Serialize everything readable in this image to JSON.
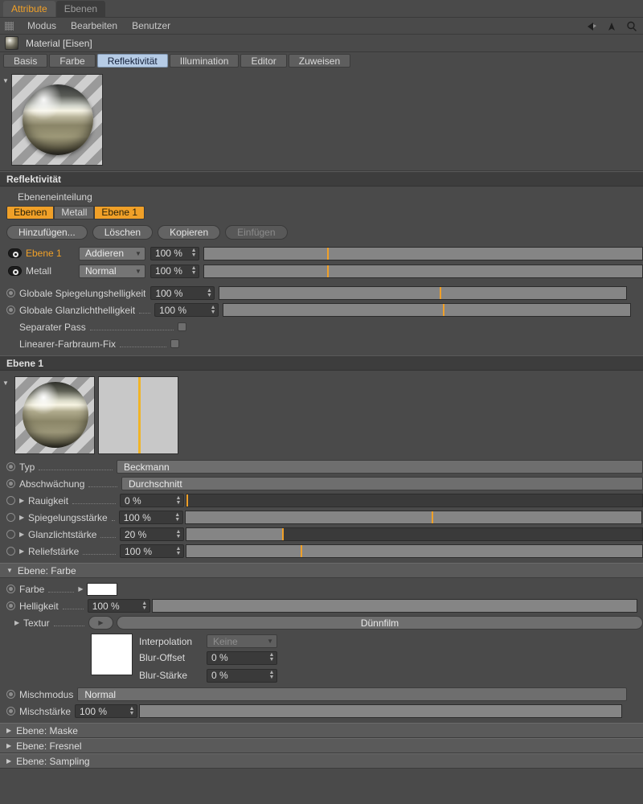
{
  "window_tabs": [
    {
      "label": "Attribute",
      "active": true
    },
    {
      "label": "Ebenen",
      "active": false
    }
  ],
  "menubar": {
    "grip_icon": "grip-dots-icon",
    "items": [
      "Modus",
      "Bearbeiten",
      "Benutzer"
    ],
    "right_icons": [
      "back-arrow-icon",
      "up-arrow-icon",
      "search-icon"
    ]
  },
  "object_header": {
    "thumb_icon": "material-sphere-icon",
    "title": "Material [Eisen]"
  },
  "property_tabs": [
    {
      "label": "Basis",
      "active": false
    },
    {
      "label": "Farbe",
      "active": false
    },
    {
      "label": "Reflektivität",
      "active": true
    },
    {
      "label": "Illumination",
      "active": false
    },
    {
      "label": "Editor",
      "active": false
    },
    {
      "label": "Zuweisen",
      "active": false
    }
  ],
  "preview": {
    "expand_icon": "triangle-down-icon",
    "sphere_icon": "material-preview-sphere"
  },
  "reflectivity": {
    "group_title": "Reflektivität",
    "subtitle": "Ebeneneinteilung",
    "split_buttons": [
      {
        "label": "Ebenen",
        "on": true
      },
      {
        "label": "Metall",
        "on": false
      },
      {
        "label": "Ebene 1",
        "on": true
      }
    ],
    "action_buttons": [
      {
        "label": "Hinzufügen...",
        "enabled": true
      },
      {
        "label": "Löschen",
        "enabled": true
      },
      {
        "label": "Kopieren",
        "enabled": true
      },
      {
        "label": "Einfügen",
        "enabled": false
      }
    ],
    "layers": [
      {
        "eye_icon": "eye-icon",
        "name": "Ebene 1",
        "selected": true,
        "mode": "Addieren",
        "opacity": "100 %",
        "slider_percent": 100,
        "tick_percent": 28
      },
      {
        "eye_icon": "eye-icon",
        "name": "Metall",
        "selected": false,
        "mode": "Normal",
        "opacity": "100 %",
        "slider_percent": 100,
        "tick_percent": 28
      }
    ],
    "globals": [
      {
        "radio_icon": "radio-filled-icon",
        "label": "Globale Spiegelungshelligkeit",
        "value": "100 %",
        "slider_percent": 100,
        "tick_percent": 54
      },
      {
        "radio_icon": "radio-filled-icon",
        "label": "Globale Glanzlichthelligkeit",
        "value": "100 %",
        "slider_percent": 100,
        "tick_percent": 54
      }
    ],
    "checkboxes": [
      {
        "label": "Separater Pass",
        "checkbox_icon": "checkbox-icon",
        "checked": false
      },
      {
        "label": "Linearer-Farbraum-Fix",
        "checkbox_icon": "checkbox-icon",
        "checked": false
      }
    ]
  },
  "layer1": {
    "group_title": "Ebene 1",
    "expand_icon": "triangle-down-icon",
    "preview_icon": "layer-preview-sphere",
    "graph_icon": "falloff-curve-graph",
    "params": [
      {
        "radio_icon": "radio-filled-icon",
        "label": "Typ",
        "type": "flat",
        "value": "Beckmann"
      },
      {
        "radio_icon": "radio-filled-icon",
        "label": "Abschwächung",
        "type": "flat",
        "value": "Durchschnitt"
      },
      {
        "radio_icon": "radio-hollow-icon",
        "label": "Rauigkeit",
        "type": "slider",
        "value": "0 %",
        "slider_percent": 0,
        "tick_percent": 0,
        "expandable": true
      },
      {
        "radio_icon": "radio-hollow-icon",
        "label": "Spiegelungsstärke",
        "type": "slider",
        "value": "100 %",
        "slider_percent": 100,
        "tick_percent": 54,
        "expandable": true
      },
      {
        "radio_icon": "radio-hollow-icon",
        "label": "Glanzlichtstärke",
        "type": "slider",
        "value": "20 %",
        "slider_percent": 21,
        "tick_percent": 21,
        "expandable": true
      },
      {
        "radio_icon": "radio-hollow-icon",
        "label": "Reliefstärke",
        "type": "slider",
        "value": "100 %",
        "slider_percent": 100,
        "tick_percent": 25,
        "expandable": true
      }
    ]
  },
  "layer_color": {
    "group_title": "Ebene: Farbe",
    "expand_icon": "triangle-down-icon",
    "color_label": "Farbe",
    "color_arrow_icon": "triangle-right-icon",
    "color_value": "#ffffff",
    "brightness_label": "Helligkeit",
    "brightness_value": "100 %",
    "brightness_slider_percent": 100,
    "texture_label": "Textur",
    "texture_expand_icon": "triangle-right-icon",
    "texture_button_icon": "triangle-right-icon",
    "texture_value": "Dünnfilm",
    "texture_swatch_color": "#ffffff",
    "interpolation_label": "Interpolation",
    "interpolation_value": "Keine",
    "blur_offset_label": "Blur-Offset",
    "blur_offset_value": "0 %",
    "blur_strength_label": "Blur-Stärke",
    "blur_strength_value": "0 %",
    "mix_mode_label": "Mischmodus",
    "mix_mode_value": "Normal",
    "mix_strength_label": "Mischstärke",
    "mix_strength_value": "100 %",
    "mix_strength_slider_percent": 100
  },
  "collapsed_groups": [
    {
      "label": "Ebene: Maske",
      "icon": "triangle-right-icon"
    },
    {
      "label": "Ebene: Fresnel",
      "icon": "triangle-right-icon"
    },
    {
      "label": "Ebene: Sampling",
      "icon": "triangle-right-icon"
    }
  ],
  "colors": {
    "accent_orange": "#f0a028",
    "tab_active_blue": "#b6cce6",
    "panel_bg": "#4a4a4a",
    "group_header_bg": "#3d3d3d"
  }
}
